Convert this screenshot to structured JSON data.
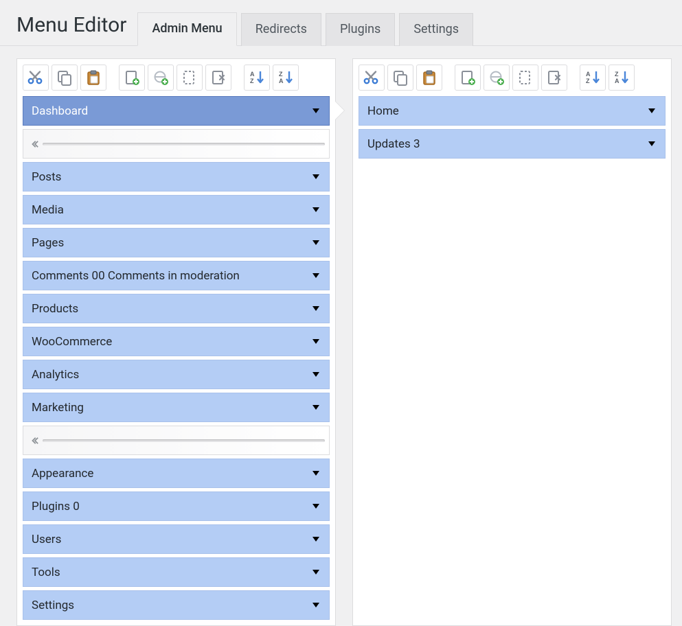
{
  "header": {
    "title": "Menu Editor",
    "tabs": [
      {
        "label": "Admin Menu",
        "active": true
      },
      {
        "label": "Redirects",
        "active": false
      },
      {
        "label": "Plugins",
        "active": false
      },
      {
        "label": "Settings",
        "active": false
      }
    ]
  },
  "toolbar_icons": {
    "cut": "cut-icon",
    "copy": "copy-icon",
    "paste": "paste-icon",
    "new": "new-icon",
    "new_sep": "new-separator-icon",
    "show": "show-icon",
    "delete": "delete-icon",
    "sort_az": "sort-asc-icon",
    "sort_za": "sort-desc-icon"
  },
  "left_panel": {
    "rows": [
      {
        "type": "item",
        "label": "Dashboard",
        "selected": true
      },
      {
        "type": "separator"
      },
      {
        "type": "item",
        "label": "Posts"
      },
      {
        "type": "item",
        "label": "Media"
      },
      {
        "type": "item",
        "label": "Pages"
      },
      {
        "type": "item",
        "label": "Comments 00 Comments in moderation"
      },
      {
        "type": "item",
        "label": "Products"
      },
      {
        "type": "item",
        "label": "WooCommerce"
      },
      {
        "type": "item",
        "label": "Analytics"
      },
      {
        "type": "item",
        "label": "Marketing"
      },
      {
        "type": "separator"
      },
      {
        "type": "item",
        "label": "Appearance"
      },
      {
        "type": "item",
        "label": "Plugins 0"
      },
      {
        "type": "item",
        "label": "Users"
      },
      {
        "type": "item",
        "label": "Tools"
      },
      {
        "type": "item",
        "label": "Settings"
      }
    ]
  },
  "right_panel": {
    "rows": [
      {
        "type": "item",
        "label": "Home"
      },
      {
        "type": "item",
        "label": "Updates 3"
      }
    ]
  }
}
